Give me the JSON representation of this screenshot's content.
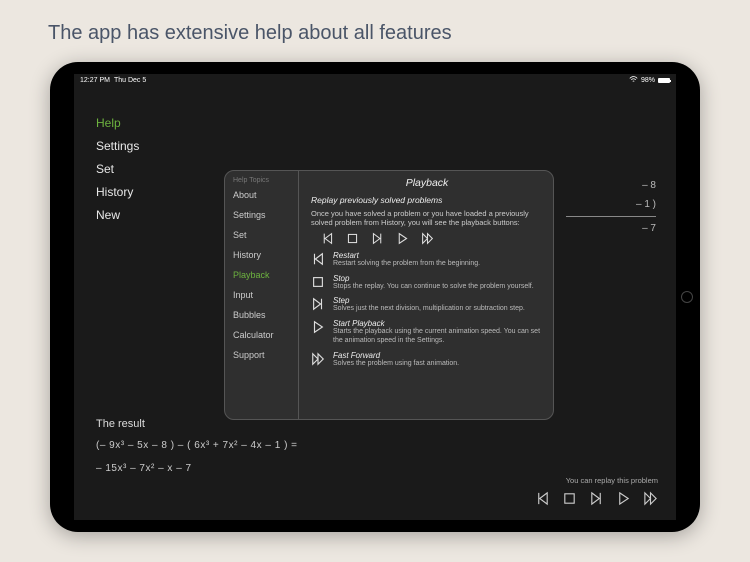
{
  "caption": "The app has extensive help about all features",
  "status": {
    "time": "12:27 PM",
    "date": "Thu Dec 5",
    "battery_pct": "98%"
  },
  "main_menu": {
    "items": [
      {
        "label": "Help",
        "active": true
      },
      {
        "label": "Settings",
        "active": false
      },
      {
        "label": "Set",
        "active": false
      },
      {
        "label": "History",
        "active": false
      },
      {
        "label": "New",
        "active": false
      }
    ]
  },
  "math_bg": {
    "line1": "–   8",
    "line2": "–   1  )",
    "line3": "–   7"
  },
  "help_panel": {
    "topics_header": "Help Topics",
    "topics": [
      {
        "label": "About",
        "active": false
      },
      {
        "label": "Settings",
        "active": false
      },
      {
        "label": "Set",
        "active": false
      },
      {
        "label": "History",
        "active": false
      },
      {
        "label": "Playback",
        "active": true
      },
      {
        "label": "Input",
        "active": false
      },
      {
        "label": "Bubbles",
        "active": false
      },
      {
        "label": "Calculator",
        "active": false
      },
      {
        "label": "Support",
        "active": false
      }
    ],
    "title": "Playback",
    "subtitle": "Replay previously solved problems",
    "intro": "Once you have solved a problem or you have loaded a previously solved problem from History, you will see the playback buttons:",
    "items": [
      {
        "icon": "restart",
        "name": "Restart",
        "desc": "Restart solving the problem from the beginning."
      },
      {
        "icon": "stop",
        "name": "Stop",
        "desc": "Stops the replay. You can continue to solve the problem yourself."
      },
      {
        "icon": "step",
        "name": "Step",
        "desc": "Solves just the next division, multiplication or subtraction step."
      },
      {
        "icon": "play",
        "name": "Start Playback",
        "desc": "Starts the playback using the current animation speed. You can set the animation speed in the Settings."
      },
      {
        "icon": "fastforward",
        "name": "Fast Forward",
        "desc": "Solves the problem using fast animation."
      }
    ]
  },
  "result": {
    "header": "The result",
    "line1": "(– 9x³  –  5x  –  8   )   –   (   6x³  + 7x²  –  4x  –   1   )   =",
    "line2": "– 15x³  –  7x²  –   x   –   7"
  },
  "replay": {
    "hint": "You can replay this problem"
  }
}
